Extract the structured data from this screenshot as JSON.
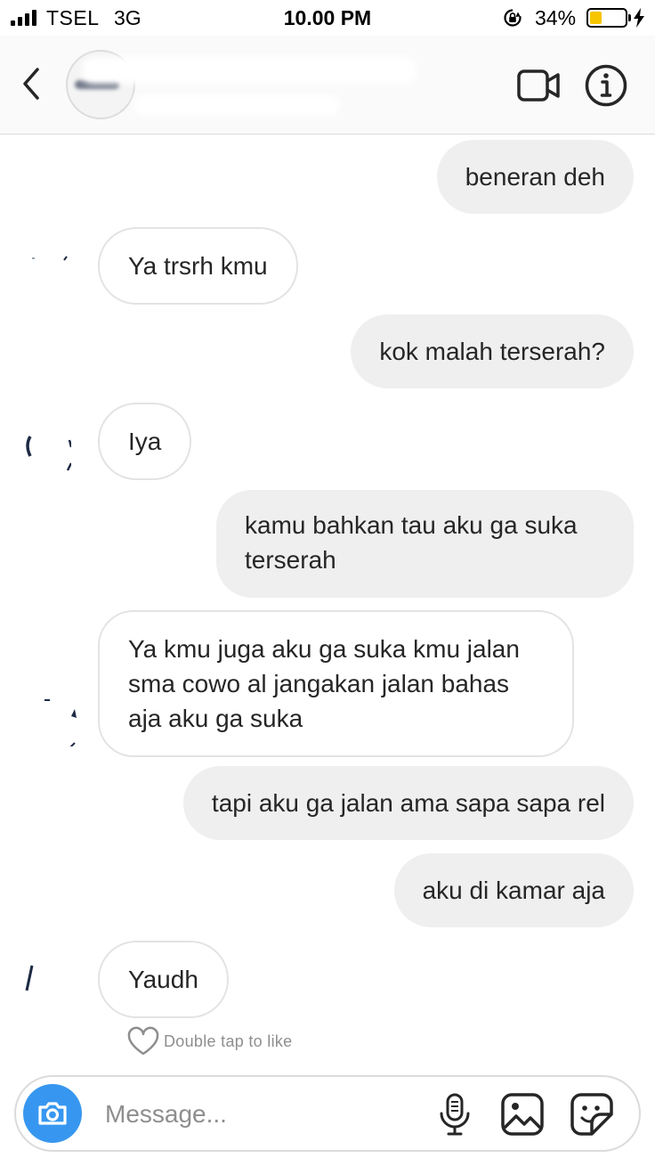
{
  "status_bar": {
    "carrier": "TSEL",
    "network": "3G",
    "time": "10.00 PM",
    "battery_percent": "34%",
    "battery_level": 0.34,
    "battery_color": "#f7c500"
  },
  "header": {
    "back_icon": "chevron-left-icon",
    "video_icon": "video-camera-icon",
    "info_icon": "info-icon"
  },
  "messages": [
    {
      "sender": "me",
      "text": "beneran deh"
    },
    {
      "sender": "them",
      "text": "Ya trsrh kmu"
    },
    {
      "sender": "me",
      "text": "kok malah terserah?"
    },
    {
      "sender": "them",
      "text": "Iya"
    },
    {
      "sender": "me",
      "text": "kamu bahkan tau aku ga suka terserah"
    },
    {
      "sender": "them",
      "text": "Ya kmu juga aku ga suka kmu jalan sma cowo al jangakan jalan bahas aja aku ga suka"
    },
    {
      "sender": "me",
      "text": "tapi aku ga jalan ama sapa sapa rel"
    },
    {
      "sender": "me",
      "text": "aku di kamar aja"
    },
    {
      "sender": "them",
      "text": "Yaudh"
    }
  ],
  "like_hint": "Double tap to like",
  "composer": {
    "placeholder": "Message...",
    "camera_color": "#3797f0"
  },
  "colors": {
    "my_bubble": "#efefef",
    "their_bubble_border": "#e3e3e3",
    "text": "#262626",
    "muted": "#8e8e8e"
  }
}
